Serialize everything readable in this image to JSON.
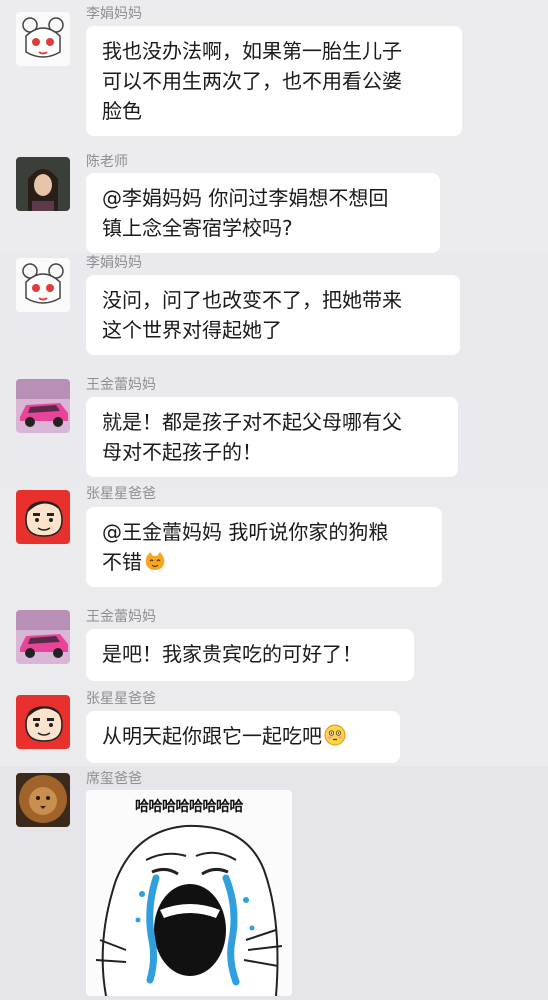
{
  "colors": {
    "page_bg": "#e9e9ed",
    "bubble_bg": "#ffffff",
    "name_text": "#8e8e93",
    "text": "#1a1a1a",
    "tear": "#2f9fe0"
  },
  "messages": [
    {
      "sender": "李娟妈妈",
      "avatar": "anime-girl-avatar",
      "text": "我也没办法啊，如果第一胎生儿子\n可以不用生两次了，也不用看公婆\n脸色"
    },
    {
      "sender": "陈老师",
      "avatar": "teacher-photo-avatar",
      "text": "@李娟妈妈 你问过李娟想不想回\n镇上念全寄宿学校吗?"
    },
    {
      "sender": "李娟妈妈",
      "avatar": "anime-girl-avatar",
      "text": "没问，问了也改变不了，把她带来\n这个世界对得起她了"
    },
    {
      "sender": "王金蕾妈妈",
      "avatar": "pink-car-avatar",
      "text": "就是！都是孩子对不起父母哪有父\n母对不起孩子的！"
    },
    {
      "sender": "张星星爸爸",
      "avatar": "crayon-shin-chan-avatar",
      "text": "@王金蕾妈妈 我听说你家的狗粮\n不错",
      "emoji": "cat-face-emoji"
    },
    {
      "sender": "王金蕾妈妈",
      "avatar": "pink-car-avatar",
      "text": "是吧！我家贵宾吃的可好了！"
    },
    {
      "sender": "张星星爸爸",
      "avatar": "crayon-shin-chan-avatar",
      "text": "从明天起你跟它一起吃吧",
      "emoji": "flushed-face-emoji"
    },
    {
      "sender": "席玺爸爸",
      "avatar": "lion-avatar",
      "sticker_text": "哈哈哈哈哈哈哈哈",
      "sticker": "crying-laughing-meme-sticker"
    }
  ]
}
